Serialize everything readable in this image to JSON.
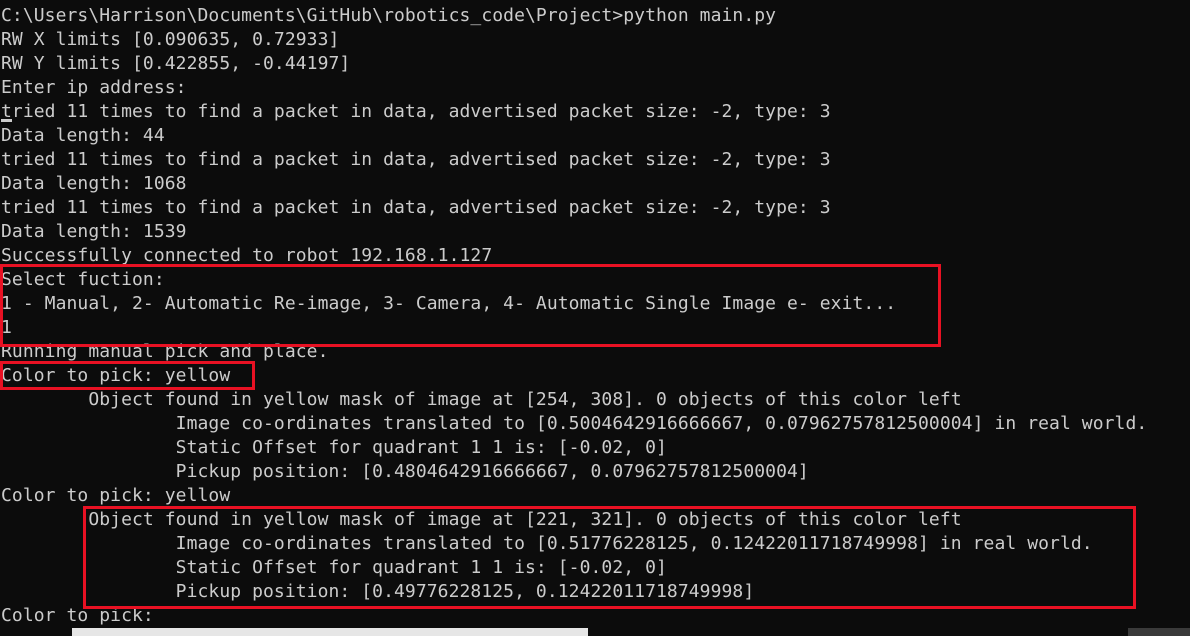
{
  "console": {
    "lines": [
      "C:\\Users\\Harrison\\Documents\\GitHub\\robotics_code\\Project>python main.py",
      "RW X limits [0.090635, 0.72933]",
      "RW Y limits [0.422855, -0.44197]",
      "Enter ip address:",
      "tried 11 times to find a packet in data, advertised packet size: -2, type: 3",
      "Data length: 44",
      "tried 11 times to find a packet in data, advertised packet size: -2, type: 3",
      "Data length: 1068",
      "tried 11 times to find a packet in data, advertised packet size: -2, type: 3",
      "Data length: 1539",
      "Successfully connected to robot 192.168.1.127",
      "Select fuction:",
      "1 - Manual, 2- Automatic Re-image, 3- Camera, 4- Automatic Single Image e- exit...",
      "1",
      "Running manual pick and place.",
      "Color to pick: yellow",
      "        Object found in yellow mask of image at [254, 308]. 0 objects of this color left",
      "                Image co-ordinates translated to [0.5004642916666667, 0.07962757812500004] in real world.",
      "                Static Offset for quadrant 1 1 is: [-0.02, 0]",
      "                Pickup position: [0.4804642916666667, 0.07962757812500004]",
      "Color to pick: yellow",
      "        Object found in yellow mask of image at [221, 321]. 0 objects of this color left",
      "                Image co-ordinates translated to [0.51776228125, 0.12422011718749998] in real world.",
      "                Static Offset for quadrant 1 1 is: [-0.02, 0]",
      "                Pickup position: [0.49776228125, 0.12422011718749998]",
      "Color to pick:"
    ]
  },
  "colors": {
    "background": "#0c0c0c",
    "text": "#cccccc",
    "highlight": "#e81123"
  }
}
